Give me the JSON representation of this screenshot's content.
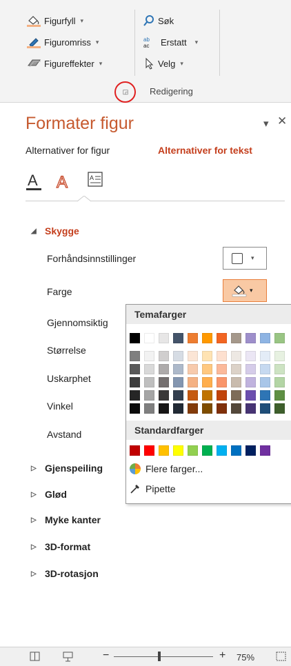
{
  "ribbon": {
    "shape_fill": "Figurfyll",
    "shape_outline": "Figuromriss",
    "shape_effects": "Figureffekter",
    "find": "Søk",
    "replace": "Erstatt",
    "select": "Velg",
    "group_editing": "Redigering"
  },
  "pane": {
    "title": "Formater figur",
    "tab_shape": "Alternativer for figur",
    "tab_text": "Alternativer for tekst"
  },
  "shadow": {
    "heading": "Skygge",
    "presets": "Forhåndsinnstillinger",
    "color": "Farge",
    "transparency": "Gjennomsiktig",
    "size": "Størrelse",
    "blur": "Uskarphet",
    "angle": "Vinkel",
    "distance": "Avstand"
  },
  "sections": [
    "Gjenspeiling",
    "Glød",
    "Myke kanter",
    "3D-format",
    "3D-rotasjon"
  ],
  "color_popup": {
    "theme_heading": "Temafarger",
    "standard_heading": "Standardfarger",
    "more_colors": "Flere farger...",
    "eyedropper": "Pipette",
    "theme_colors": [
      "#000000",
      "#ffffff",
      "#e7e6e6",
      "#44546a",
      "#ed7d31",
      "#ff9900",
      "#f26522",
      "#a5988b",
      "#9e8fcb",
      "#8eb4e3",
      "#99c584"
    ],
    "theme_tints": [
      [
        "#7f7f7f",
        "#f2f2f2",
        "#d0cece",
        "#d6dce4",
        "#fbe5d5",
        "#ffe3b3",
        "#fde0cf",
        "#ede8e3",
        "#ebe6f4",
        "#e3ecf7",
        "#e7f1e1"
      ],
      [
        "#595959",
        "#d9d9d9",
        "#aeabab",
        "#adb9ca",
        "#f7caac",
        "#ffc880",
        "#fbb99a",
        "#dcd2c8",
        "#d5cce9",
        "#c6d9f0",
        "#cde3c3"
      ],
      [
        "#3f3f3f",
        "#bfbfbf",
        "#757070",
        "#8496b0",
        "#f4b183",
        "#ffae4d",
        "#f9956a",
        "#c9bbad",
        "#c0b3de",
        "#a9c6e8",
        "#b3d5a5"
      ],
      [
        "#262626",
        "#a5a5a5",
        "#3a3838",
        "#333f4f",
        "#c55a11",
        "#bf7300",
        "#c1440b",
        "#7e6c59",
        "#6b4eae",
        "#2e75b5",
        "#5e8f43"
      ],
      [
        "#0c0c0c",
        "#7f7f7f",
        "#171616",
        "#222a35",
        "#833c0b",
        "#7f4d00",
        "#80300a",
        "#54483b",
        "#473474",
        "#1f4e79",
        "#3e5f2c"
      ]
    ],
    "standard_colors": [
      "#c00000",
      "#ff0000",
      "#ffc000",
      "#ffff00",
      "#92d050",
      "#00b050",
      "#00b0f0",
      "#0070c0",
      "#002060",
      "#7030a0"
    ]
  },
  "status": {
    "zoom": "75%"
  }
}
